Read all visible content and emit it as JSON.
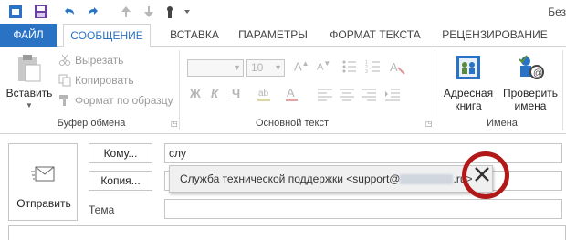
{
  "window": {
    "title_fragment": "Без"
  },
  "quick_access": {
    "icons": [
      "save-icon",
      "undo-icon",
      "redo-icon",
      "up-arrow-icon",
      "down-arrow-icon",
      "touch-mode-icon",
      "customize-dropdown-icon"
    ]
  },
  "tabs": [
    {
      "label": "ФАЙЛ"
    },
    {
      "label": "СООБЩЕНИЕ"
    },
    {
      "label": "ВСТАВКА"
    },
    {
      "label": "ПАРАМЕТРЫ"
    },
    {
      "label": "ФОРМАТ ТЕКСТА"
    },
    {
      "label": "РЕЦЕНЗИРОВАНИЕ"
    }
  ],
  "ribbon": {
    "clipboard": {
      "paste_label": "Вставить",
      "cut_label": "Вырезать",
      "copy_label": "Копировать",
      "format_painter_label": "Формат по образцу",
      "group_label": "Буфер обмена"
    },
    "basic_text": {
      "font_name_value": "",
      "font_size_value": "10",
      "bold": "Ж",
      "italic": "К",
      "underline": "Ч",
      "group_label": "Основной текст"
    },
    "names": {
      "address_book_label_1": "Адресная",
      "address_book_label_2": "книга",
      "check_names_label_1": "Проверить",
      "check_names_label_2": "имена",
      "group_label": "Имена"
    }
  },
  "compose": {
    "send_label": "Отправить",
    "to_button": "Кому...",
    "to_value": "слу",
    "cc_button": "Копия...",
    "cc_value": "",
    "subject_label": "Тема",
    "subject_value": ""
  },
  "autocomplete": {
    "suggestion_prefix": "Служба технической поддержки <support@",
    "suggestion_suffix": ".ru>",
    "delete_icon": "close-icon"
  },
  "colors": {
    "accent": "#2a73c4",
    "highlight_circle": "#b21818"
  }
}
